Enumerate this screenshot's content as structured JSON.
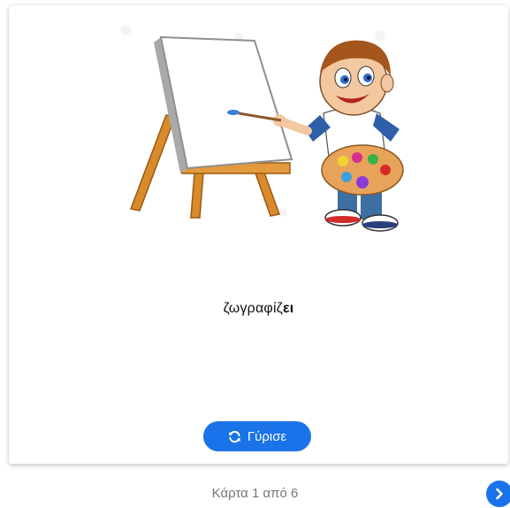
{
  "card": {
    "word_stem": "ζωγραφίζ",
    "word_ending": "ει",
    "illustration_icon": "boy-painting-at-easel-illustration"
  },
  "flip_button": {
    "label": "Γύρισε",
    "icon": "refresh-icon"
  },
  "pagination": {
    "text": "Κάρτα 1 από 6",
    "next_icon": "chevron-right-icon"
  },
  "colors": {
    "accent": "#1a73e8",
    "counter_text": "#777777"
  }
}
